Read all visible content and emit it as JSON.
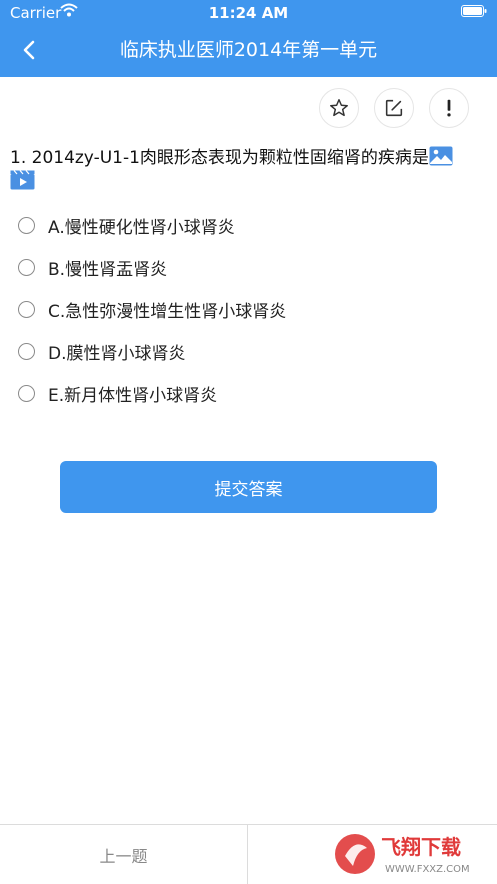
{
  "status": {
    "carrier": "Carrier",
    "time": "11:24 AM"
  },
  "nav": {
    "title": "临床执业医师2014年第一单元",
    "back_icon": "chevron-left-icon"
  },
  "toolbar": {
    "icons": [
      "star-icon",
      "edit-icon",
      "exclamation-icon"
    ]
  },
  "question": {
    "text": "1. 2014zy-U1-1肉眼形态表现为颗粒性固缩肾的疾病是"
  },
  "options": [
    {
      "label": "A.慢性硬化性肾小球肾炎"
    },
    {
      "label": "B.慢性肾盂肾炎"
    },
    {
      "label": "C.急性弥漫性增生性肾小球肾炎"
    },
    {
      "label": "D.膜性肾小球肾炎"
    },
    {
      "label": "E.新月体性肾小球肾炎"
    }
  ],
  "submit": {
    "label": "提交答案"
  },
  "bottom": {
    "prev_label": "上一题"
  },
  "watermark": {
    "brand": "飞翔下载",
    "url": "WWW.FXXZ.COM"
  },
  "colors": {
    "accent": "#3f96ee",
    "watermark_red": "#e03a3a"
  }
}
